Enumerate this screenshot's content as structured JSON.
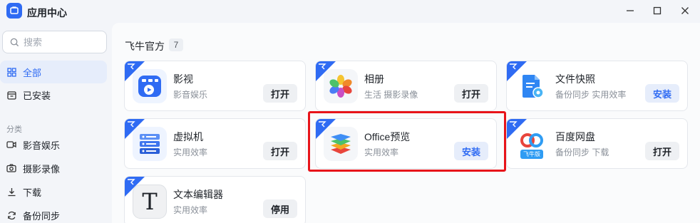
{
  "window": {
    "title": "应用中心",
    "logo_icon": "app-center-logo",
    "controls": [
      "minimize-icon",
      "maximize-icon",
      "close-icon"
    ]
  },
  "sidebar": {
    "search_placeholder": "搜索",
    "items": [
      {
        "label": "全部",
        "icon": "grid-icon",
        "active": true
      },
      {
        "label": "已安装",
        "icon": "installed-box-icon",
        "active": false
      }
    ],
    "category_label": "分类",
    "categories": [
      {
        "label": "影音娱乐",
        "icon": "video-icon"
      },
      {
        "label": "摄影录像",
        "icon": "camera-icon"
      },
      {
        "label": "下载",
        "icon": "download-icon"
      },
      {
        "label": "备份同步",
        "icon": "sync-icon"
      }
    ]
  },
  "main": {
    "group_title": "飞牛官方",
    "group_count": "7",
    "apps": [
      {
        "name": "影视",
        "desc": "影音娱乐",
        "action": "打开",
        "icon": "play-video-app-icon"
      },
      {
        "name": "相册",
        "desc": "生活 摄影录像",
        "action": "打开",
        "icon": "photos-flower-app-icon"
      },
      {
        "name": "文件快照",
        "desc": "备份同步 实用效率",
        "action": "安装",
        "icon": "file-snapshot-app-icon"
      },
      {
        "name": "虚拟机",
        "desc": "实用效率",
        "action": "打开",
        "icon": "server-stack-app-icon"
      },
      {
        "name": "Office预览",
        "desc": "实用效率",
        "action": "安装",
        "icon": "layers-app-icon"
      },
      {
        "name": "百度网盘",
        "desc": "备份同步 下载",
        "action": "打开",
        "icon": "baidu-cloud-app-icon",
        "icon_text": "飞牛版"
      },
      {
        "name": "文本编辑器",
        "desc": "实用效率",
        "action": "停用",
        "icon": "text-editor-app-icon",
        "icon_text": "T"
      }
    ]
  },
  "colors": {
    "accent": "#2f6bf3",
    "highlight": "#e8141a",
    "background": "#f3f5f9"
  }
}
